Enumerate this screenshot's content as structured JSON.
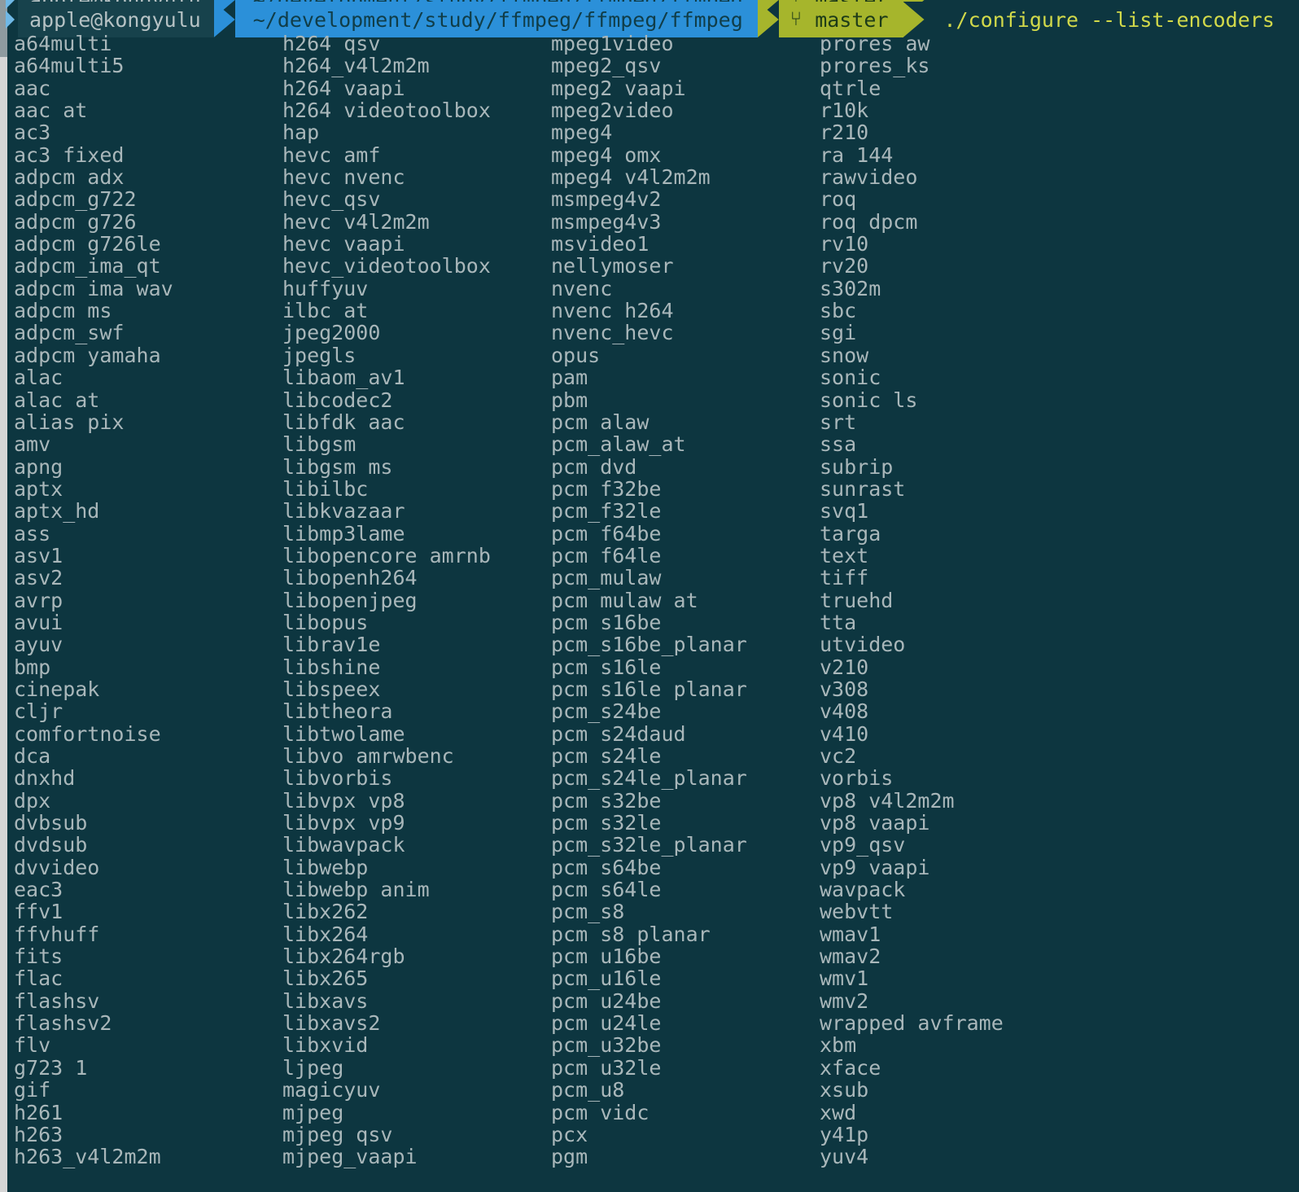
{
  "terminal": {
    "background_color": "#0d3640",
    "text_color": "#a9b7ba",
    "prompt": {
      "arrow_icon": "prompt-arrow",
      "user_segment": {
        "label": "apple@kongyulu",
        "bg_color": "#17424c",
        "fg_color": "#b6c2c4"
      },
      "path_segment": {
        "label": "~/development/study/ffmpeg/ffmpeg/ffmpeg",
        "bg_color": "#2b90d9",
        "fg_color": "#103d48"
      },
      "branch_segment": {
        "icon": "git-branch-icon",
        "icon_glyph": "⑂",
        "label": "master",
        "bg_color": "#a6b52c",
        "fg_color": "#1d3b18"
      },
      "command": {
        "text": "./configure --list-encoders",
        "fg_color": "#d2d94a"
      }
    },
    "scrollbar": {
      "track_color": "#d6d6d6",
      "thumb_color": "#8f9ba0"
    }
  },
  "output": {
    "columns": [
      {
        "name": "column-1",
        "items": [
          "a64multi",
          "a64multi5",
          "aac",
          "aac_at",
          "ac3",
          "ac3_fixed",
          "adpcm_adx",
          "adpcm_g722",
          "adpcm_g726",
          "adpcm_g726le",
          "adpcm_ima_qt",
          "adpcm_ima_wav",
          "adpcm_ms",
          "adpcm_swf",
          "adpcm_yamaha",
          "alac",
          "alac_at",
          "alias_pix",
          "amv",
          "apng",
          "aptx",
          "aptx_hd",
          "ass",
          "asv1",
          "asv2",
          "avrp",
          "avui",
          "ayuv",
          "bmp",
          "cinepak",
          "cljr",
          "comfortnoise",
          "dca",
          "dnxhd",
          "dpx",
          "dvbsub",
          "dvdsub",
          "dvvideo",
          "eac3",
          "ffv1",
          "ffvhuff",
          "fits",
          "flac",
          "flashsv",
          "flashsv2",
          "flv",
          "g723_1",
          "gif",
          "h261",
          "h263",
          "h263_v4l2m2m"
        ]
      },
      {
        "name": "column-2",
        "items": [
          "h264_qsv",
          "h264_v4l2m2m",
          "h264_vaapi",
          "h264_videotoolbox",
          "hap",
          "hevc_amf",
          "hevc_nvenc",
          "hevc_qsv",
          "hevc_v4l2m2m",
          "hevc_vaapi",
          "hevc_videotoolbox",
          "huffyuv",
          "ilbc_at",
          "jpeg2000",
          "jpegls",
          "libaom_av1",
          "libcodec2",
          "libfdk_aac",
          "libgsm",
          "libgsm_ms",
          "libilbc",
          "libkvazaar",
          "libmp3lame",
          "libopencore_amrnb",
          "libopenh264",
          "libopenjpeg",
          "libopus",
          "librav1e",
          "libshine",
          "libspeex",
          "libtheora",
          "libtwolame",
          "libvo_amrwbenc",
          "libvorbis",
          "libvpx_vp8",
          "libvpx_vp9",
          "libwavpack",
          "libwebp",
          "libwebp_anim",
          "libx262",
          "libx264",
          "libx264rgb",
          "libx265",
          "libxavs",
          "libxavs2",
          "libxvid",
          "ljpeg",
          "magicyuv",
          "mjpeg",
          "mjpeg_qsv",
          "mjpeg_vaapi"
        ]
      },
      {
        "name": "column-3",
        "items": [
          "mpeg1video",
          "mpeg2_qsv",
          "mpeg2_vaapi",
          "mpeg2video",
          "mpeg4",
          "mpeg4_omx",
          "mpeg4_v4l2m2m",
          "msmpeg4v2",
          "msmpeg4v3",
          "msvideo1",
          "nellymoser",
          "nvenc",
          "nvenc_h264",
          "nvenc_hevc",
          "opus",
          "pam",
          "pbm",
          "pcm_alaw",
          "pcm_alaw_at",
          "pcm_dvd",
          "pcm_f32be",
          "pcm_f32le",
          "pcm_f64be",
          "pcm_f64le",
          "pcm_mulaw",
          "pcm_mulaw_at",
          "pcm_s16be",
          "pcm_s16be_planar",
          "pcm_s16le",
          "pcm_s16le_planar",
          "pcm_s24be",
          "pcm_s24daud",
          "pcm_s24le",
          "pcm_s24le_planar",
          "pcm_s32be",
          "pcm_s32le",
          "pcm_s32le_planar",
          "pcm_s64be",
          "pcm_s64le",
          "pcm_s8",
          "pcm_s8_planar",
          "pcm_u16be",
          "pcm_u16le",
          "pcm_u24be",
          "pcm_u24le",
          "pcm_u32be",
          "pcm_u32le",
          "pcm_u8",
          "pcm_vidc",
          "pcx",
          "pgm"
        ]
      },
      {
        "name": "column-4",
        "items": [
          "prores_aw",
          "prores_ks",
          "qtrle",
          "r10k",
          "r210",
          "ra_144",
          "rawvideo",
          "roq",
          "roq_dpcm",
          "rv10",
          "rv20",
          "s302m",
          "sbc",
          "sgi",
          "snow",
          "sonic",
          "sonic_ls",
          "srt",
          "ssa",
          "subrip",
          "sunrast",
          "svq1",
          "targa",
          "text",
          "tiff",
          "truehd",
          "tta",
          "utvideo",
          "v210",
          "v308",
          "v408",
          "v410",
          "vc2",
          "vorbis",
          "vp8_v4l2m2m",
          "vp8_vaapi",
          "vp9_qsv",
          "vp9_vaapi",
          "wavpack",
          "webvtt",
          "wmav1",
          "wmav2",
          "wmv1",
          "wmv2",
          "wrapped_avframe",
          "xbm",
          "xface",
          "xsub",
          "xwd",
          "y41p",
          "yuv4"
        ]
      }
    ]
  }
}
